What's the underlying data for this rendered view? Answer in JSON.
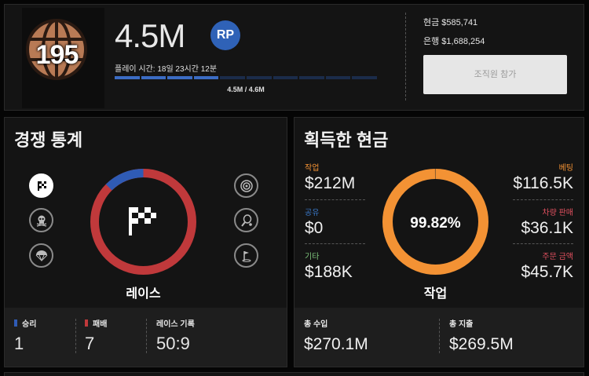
{
  "profile": {
    "rank": "195",
    "rp_value": "4.5M",
    "rp_badge": "RP",
    "playtime": "플레이 시간: 18일 23시간 12분",
    "progress_label": "4.5M / 4.6M",
    "progress_fraction": 0.978,
    "cash": "현금 $585,741",
    "bank": "은행 $1,688,254",
    "join_button": "조직원 참가"
  },
  "competitive": {
    "title": "경쟁 통계",
    "selected_label": "레이스",
    "left_icons": [
      "race-flag-icon",
      "skull-icon",
      "parachute-icon"
    ],
    "right_icons": [
      "target-icon",
      "golf-icon",
      "tennis-icon"
    ],
    "ring": {
      "wins": 1,
      "losses": 7,
      "win_color": "#2f5bb5",
      "loss_color": "#c0393b"
    },
    "footer": {
      "wins_label": "승리",
      "wins_value": "1",
      "losses_label": "패배",
      "losses_value": "7",
      "record_label": "레이스 기록",
      "record_value": "50:9"
    }
  },
  "cash_earned": {
    "title": "획득한 현금",
    "center_pct": "99.82%",
    "center_label": "작업",
    "ring_fraction": 0.9982,
    "ring_color": "#f39234",
    "left": [
      {
        "label": "작업",
        "value": "$212M",
        "color": "#f39234"
      },
      {
        "label": "공유",
        "value": "$0",
        "color": "#3a78c8"
      },
      {
        "label": "기타",
        "value": "$188K",
        "color": "#7cc27a"
      }
    ],
    "right": [
      {
        "label": "베팅",
        "value": "$116.5K",
        "color": "#f39234"
      },
      {
        "label": "차량 판매",
        "value": "$36.1K",
        "color": "#e0505f"
      },
      {
        "label": "주문 금액",
        "value": "$45.7K",
        "color": "#e0505f"
      }
    ],
    "footer": {
      "income_label": "총 수입",
      "income_value": "$270.1M",
      "spend_label": "총 지출",
      "spend_value": "$269.5M"
    }
  }
}
